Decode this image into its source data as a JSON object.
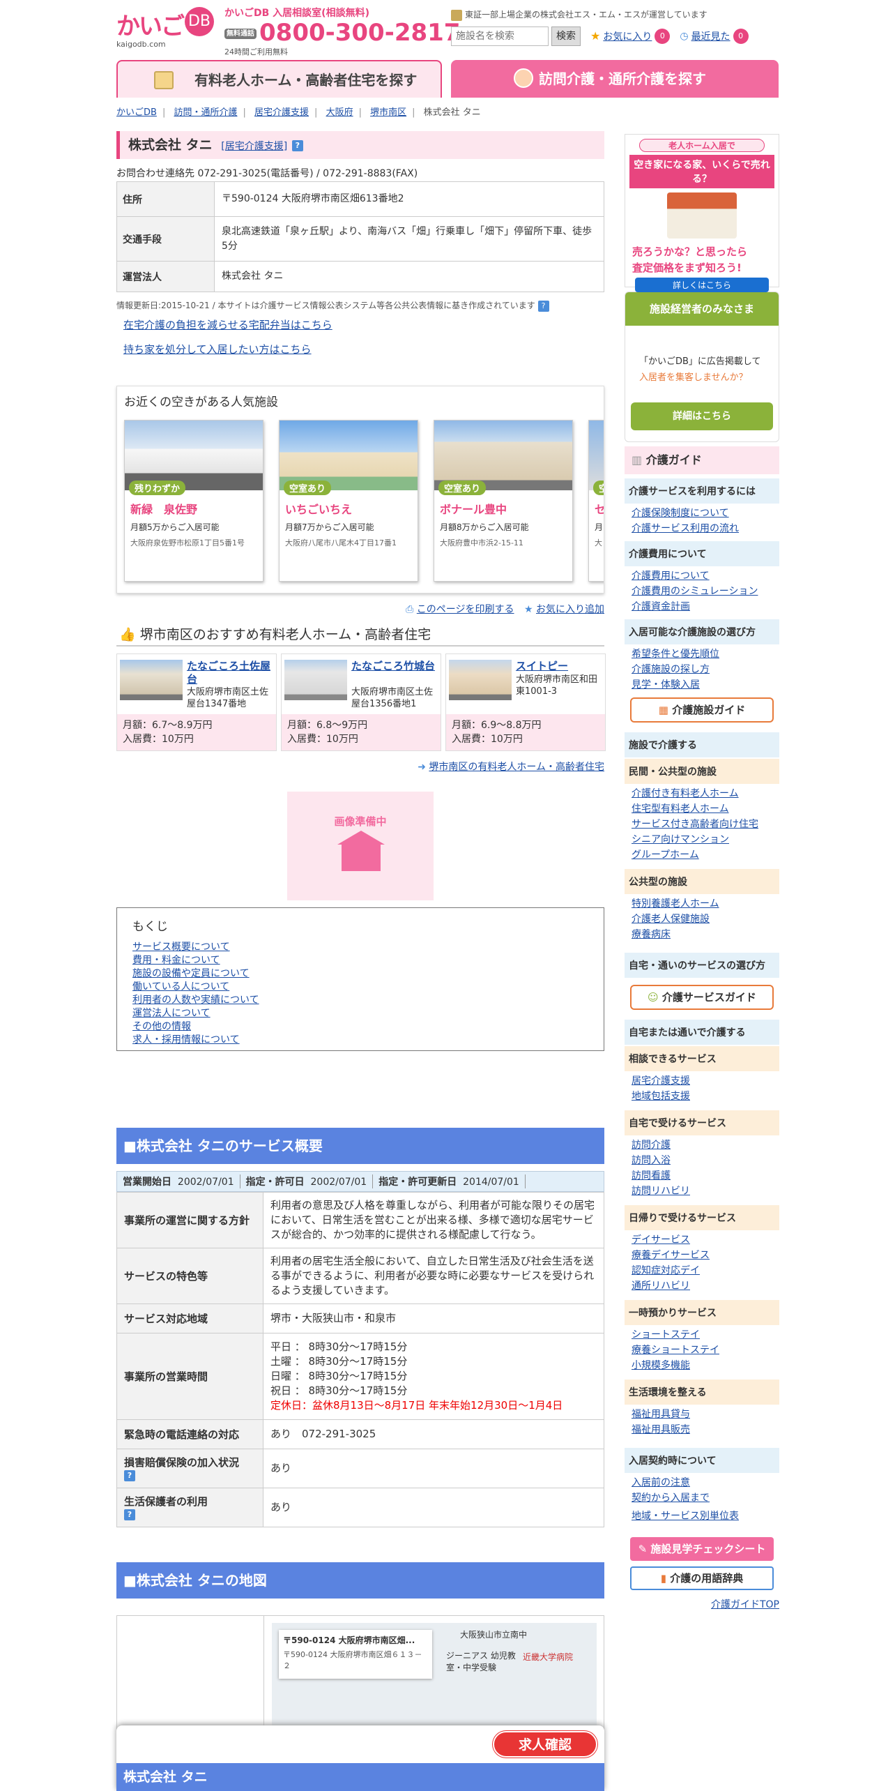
{
  "header": {
    "logo_text": "かいご",
    "logo_db": "DB",
    "logo_url": "kaigodb.com",
    "tel_label": "かいごDB 入居相談室(相談無料)",
    "tel_badge": "無料通話",
    "tel_number": "0800-300-2817",
    "tel_hours": "24時間ご利用無料",
    "operator": "東証一部上場企業の株式会社エス・エム・エスが運営しています",
    "search_placeholder": "施設名を検索",
    "search_button": "検索",
    "fav_label": "お気に入り",
    "fav_count": "0",
    "recent_label": "最近見た",
    "recent_count": "0"
  },
  "nav": {
    "tab1": "有料老人ホーム・高齢者住宅を探す",
    "tab2": "訪問介護・通所介護を探す"
  },
  "breadcrumb": [
    "かいごDB",
    "訪問・通所介護",
    "居宅介護支援",
    "大阪府",
    "堺市南区"
  ],
  "breadcrumb_current": "株式会社 タニ",
  "facility": {
    "name": "株式会社 タニ",
    "type_link": "[居宅介護支援]",
    "contact": "お問合わせ連絡先 072-291-3025(電話番号) / 072-291-8883(FAX)",
    "rows": [
      {
        "label": "住所",
        "value": "〒590-0124 大阪府堺市南区畑613番地2"
      },
      {
        "label": "交通手段",
        "value": "泉北高速鉄道「泉ヶ丘駅」より、南海バス「畑」行乗車し「畑下」停留所下車、徒歩5分"
      },
      {
        "label": "運営法人",
        "value": "株式会社 タニ"
      }
    ],
    "updated": "情報更新日:2015-10-21 / 本サイトは介護サービス情報公表システム等各公共公表情報に基き作成されています",
    "link1": "在宅介護の負担を減らせる宅配弁当はこちら",
    "link2": "持ち家を処分して入居したい方はこちら"
  },
  "nearby": {
    "title": "お近くの空きがある人気施設",
    "cards": [
      {
        "status": "残りわずか",
        "name": "新緑　泉佐野",
        "price": "月額5万からご入居可能",
        "address": "大阪府泉佐野市松原1丁目5番1号"
      },
      {
        "status": "空室あり",
        "name": "いちごいちえ",
        "price": "月額7万からご入居可能",
        "address": "大阪府八尾市八尾木4丁目17番1"
      },
      {
        "status": "空室あり",
        "name": "ボナール豊中",
        "price": "月額8万からご入居可能",
        "address": "大阪府豊中市浜2-15-11"
      },
      {
        "status": "空",
        "name": "セ",
        "price": "月",
        "address": "大"
      }
    ]
  },
  "actions": {
    "print": "このページを印刷する",
    "fav_add": "お気に入り追加"
  },
  "recommend": {
    "title": "堺市南区のおすすめ有料老人ホーム・高齢者住宅",
    "items": [
      {
        "name": "たなごころ土佐屋台",
        "address": "大阪府堺市南区土佐屋台1347番地",
        "monthly": "月額：6.7～8.9万円",
        "entry": "入居費：10万円"
      },
      {
        "name": "たなごころ竹城台",
        "address": "大阪府堺市南区土佐屋台1356番地1",
        "monthly": "月額：6.8～9万円",
        "entry": "入居費：10万円"
      },
      {
        "name": "スイトピー",
        "address": "大阪府堺市南区和田東1001-3",
        "monthly": "月額：6.9～8.8万円",
        "entry": "入居費：10万円"
      }
    ],
    "more": "堺市南区の有料老人ホーム・高齢者住宅",
    "no_image": "画像準備中"
  },
  "toc": {
    "title": "もくじ",
    "items": [
      "サービス概要について",
      "費用・料金について",
      "施設の設備や定員について",
      "働いている人について",
      "利用者の人数や実績について",
      "運営法人について",
      "その他の情報",
      "求人・採用情報について"
    ]
  },
  "service": {
    "title": "■株式会社 タニのサービス概要",
    "dates": [
      {
        "label": "営業開始日",
        "value": "2002/07/01"
      },
      {
        "label": "指定・許可日",
        "value": "2002/07/01"
      },
      {
        "label": "指定・許可更新日",
        "value": "2014/07/01"
      }
    ],
    "rows": [
      {
        "label": "事業所の運営に関する方針",
        "value": "利用者の意思及び人格を尊重しながら、利用者が可能な限りその居宅において、日常生活を営むことが出来る様、多様で適切な居宅サービスが総合的、かつ効率的に提供される様配慮して行なう。"
      },
      {
        "label": "サービスの特色等",
        "value": "利用者の居宅生活全般において、自立した日常生活及び社会生活を送る事ができるように、利用者が必要な時に必要なサービスを受けられるよう支援していきます。"
      },
      {
        "label": "サービス対応地域",
        "value": "堺市・大阪狭山市・和泉市"
      }
    ],
    "hours_label": "事業所の営業時間",
    "hours": [
      "平日 ： 8時30分～17時15分",
      "土曜 ： 8時30分～17時15分",
      "日曜 ： 8時30分～17時15分",
      "祝日 ： 8時30分～17時15分"
    ],
    "closed": "定休日：盆休8月13日～8月17日 年末年始12月30日～1月4日",
    "emergency_label": "緊急時の電話連絡の対応",
    "emergency_value": "あり　072-291-3025",
    "insurance_label": "損害賠償保険の加入状況",
    "insurance_value": "あり",
    "welfare_label": "生活保護者の利用",
    "welfare_value": "あり"
  },
  "map": {
    "title": "■株式会社 タニの地図",
    "popup_title": "〒590-0124 大阪府堺市南区畑...",
    "popup_addr": "〒590-0124 大阪府堺市南区畑６１３－２",
    "label1": "大阪狭山市立南中",
    "label2": "ジーニアス 幼児教室・中学受験",
    "label3": "近畿大学病院"
  },
  "sidebar": {
    "ad1_head": "老人ホーム入居で",
    "ad1_q": "空き家になる家、いくらで売れる？",
    "ad1_sub1": "売ろうかな？と思ったら",
    "ad1_sub2": "査定価格をまず知ろう!",
    "ad1_btn": "詳しくはこちら",
    "ad2_head": "施設経営者のみなさま",
    "ad2_text1": "「かいごDB」に広告掲載して",
    "ad2_text2": "入居者を集客しませんか？",
    "ad2_btn": "詳細はこちら",
    "guide_title": "介護ガイド",
    "g1": "介護サービスを利用するには",
    "g1_links": [
      "介護保険制度について",
      "介護サービス利用の流れ"
    ],
    "g2": "介護費用について",
    "g2_links": [
      "介護費用について",
      "介護費用のシミュレーション",
      "介護資金計画"
    ],
    "g3": "入居可能な介護施設の選び方",
    "g3_links": [
      "希望条件と優先順位",
      "介護施設の探し方",
      "見学・体験入居"
    ],
    "g3_btn": "介護施設ガイド",
    "g4": "施設で介護する",
    "g4a": "民間・公共型の施設",
    "g4a_links": [
      "介護付き有料老人ホーム",
      "住宅型有料老人ホーム",
      "サービス付き高齢者向け住宅",
      "シニア向けマンション",
      "グループホーム"
    ],
    "g4b": "公共型の施設",
    "g4b_links": [
      "特別養護老人ホーム",
      "介護老人保健施設",
      "療養病床"
    ],
    "g5": "自宅・通いのサービスの選び方",
    "g5_btn": "介護サービスガイド",
    "g6": "自宅または通いで介護する",
    "g6a": "相談できるサービス",
    "g6a_links": [
      "居宅介護支援",
      "地域包括支援"
    ],
    "g6b": "自宅で受けるサービス",
    "g6b_links": [
      "訪問介護",
      "訪問入浴",
      "訪問看護",
      "訪問リハビリ"
    ],
    "g6c": "日帰りで受けるサービス",
    "g6c_links": [
      "デイサービス",
      "療養デイサービス",
      "認知症対応デイ",
      "通所リハビリ"
    ],
    "g6d": "一時預かりサービス",
    "g6d_links": [
      "ショートステイ",
      "療養ショートステイ",
      "小規模多機能"
    ],
    "g6e": "生活環境を整える",
    "g6e_links": [
      "福祉用具貸与",
      "福祉用具販売"
    ],
    "g7": "入居契約時について",
    "g7_links": [
      "入居前の注意",
      "契約から入居まで",
      "地域・サービス別単位表"
    ],
    "btn_check": "施設見学チェックシート",
    "btn_dict": "介護の用語辞典",
    "guide_top": "介護ガイドTOP"
  },
  "bottom": {
    "confirm": "求人確認",
    "name": "株式会社 タニ"
  },
  "colors": {
    "accent": "#e8457f",
    "blue": "#5a83e0",
    "link": "#1d4fa6",
    "green": "#8bb23a"
  }
}
